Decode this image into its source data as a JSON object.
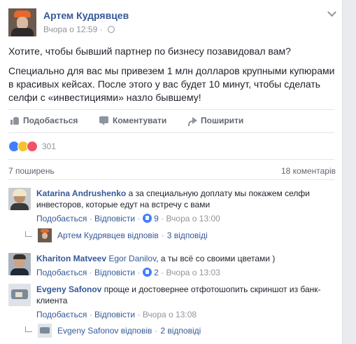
{
  "post": {
    "author": "Артем Кудрявцев",
    "time": "Вчора о 12:59",
    "dot": "·",
    "paragraphs": [
      "Хотите, чтобы бывший партнер по бизнесу позавидовал вам?",
      "Специально для вас мы привезем 1 млн долларов крупными купюрами в красивых кейсах. После этого у вас будет 10 минут, чтобы сделать селфи с «инвестициями» назло бывшему!"
    ],
    "actions": {
      "like": "Подобається",
      "comment": "Коментувати",
      "share": "Поширити"
    },
    "reactions_count": "301",
    "shares": "7 поширень",
    "comments_count": "18 коментарів"
  },
  "comments": [
    {
      "name": "Katarina Andrushenko",
      "text": " а за специальную доплату мы покажем селфи инвесторов, которые едут на встречу с вами",
      "like": "Подобається",
      "reply": "Відповісти",
      "likes": "9",
      "time": "Вчора о 13:00",
      "replies": {
        "author": "Артем Кудрявцев відповів",
        "count": "3 відповіді"
      }
    },
    {
      "name": "Khariton Matveev",
      "mention": "Egor Danilov",
      "text": ", а ты всё со своими цветами )",
      "like": "Подобається",
      "reply": "Відповісти",
      "likes": "2",
      "time": "Вчора о 13:03"
    },
    {
      "name": "Evgeny Safonov",
      "text": " проще и достовернее отфотошопить скриншот из банк-клиента",
      "like": "Подобається",
      "reply": "Відповісти",
      "time": "Вчора о 13:08",
      "replies": {
        "author": "Evgeny Safonov відповів",
        "count": "2 відповіді"
      }
    }
  ],
  "sep": "·",
  "colors": {
    "link": "#365899",
    "muted": "#90949c",
    "like_blue": "#4080ff",
    "haha_yellow": "#f7c12b",
    "love_red": "#f25268"
  }
}
